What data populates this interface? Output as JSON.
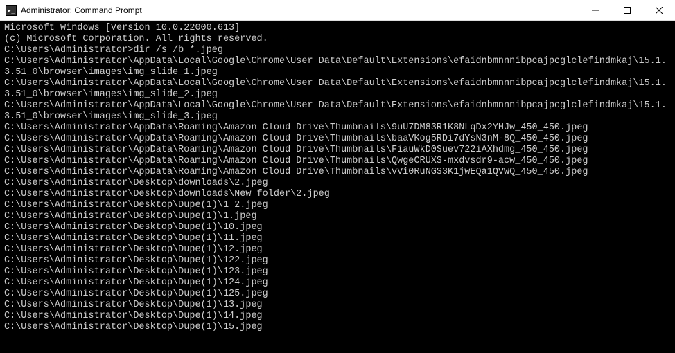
{
  "window": {
    "title": "Administrator: Command Prompt"
  },
  "terminal": {
    "header_lines": [
      "Microsoft Windows [Version 10.0.22000.613]",
      "(c) Microsoft Corporation. All rights reserved.",
      ""
    ],
    "prompt": "C:\\Users\\Administrator>",
    "command": "dir /s /b *.jpeg",
    "output_lines": [
      "C:\\Users\\Administrator\\AppData\\Local\\Google\\Chrome\\User Data\\Default\\Extensions\\efaidnbmnnnibpcajpcglclefindmkaj\\15.1.3.51_0\\browser\\images\\img_slide_1.jpeg",
      "C:\\Users\\Administrator\\AppData\\Local\\Google\\Chrome\\User Data\\Default\\Extensions\\efaidnbmnnnibpcajpcglclefindmkaj\\15.1.3.51_0\\browser\\images\\img_slide_2.jpeg",
      "C:\\Users\\Administrator\\AppData\\Local\\Google\\Chrome\\User Data\\Default\\Extensions\\efaidnbmnnnibpcajpcglclefindmkaj\\15.1.3.51_0\\browser\\images\\img_slide_3.jpeg",
      "C:\\Users\\Administrator\\AppData\\Roaming\\Amazon Cloud Drive\\Thumbnails\\9uU7DM83R1K8NLqDx2YHJw_450_450.jpeg",
      "C:\\Users\\Administrator\\AppData\\Roaming\\Amazon Cloud Drive\\Thumbnails\\baaVKog5RDi7dYsN3nM-8Q_450_450.jpeg",
      "C:\\Users\\Administrator\\AppData\\Roaming\\Amazon Cloud Drive\\Thumbnails\\FiauWkD0Suev722iAXhdmg_450_450.jpeg",
      "C:\\Users\\Administrator\\AppData\\Roaming\\Amazon Cloud Drive\\Thumbnails\\QwgeCRUXS-mxdvsdr9-acw_450_450.jpeg",
      "C:\\Users\\Administrator\\AppData\\Roaming\\Amazon Cloud Drive\\Thumbnails\\vVi0RuNGS3K1jwEQa1QVWQ_450_450.jpeg",
      "C:\\Users\\Administrator\\Desktop\\downloads\\2.jpeg",
      "C:\\Users\\Administrator\\Desktop\\downloads\\New folder\\2.jpeg",
      "C:\\Users\\Administrator\\Desktop\\Dupe(1)\\1 2.jpeg",
      "C:\\Users\\Administrator\\Desktop\\Dupe(1)\\1.jpeg",
      "C:\\Users\\Administrator\\Desktop\\Dupe(1)\\10.jpeg",
      "C:\\Users\\Administrator\\Desktop\\Dupe(1)\\11.jpeg",
      "C:\\Users\\Administrator\\Desktop\\Dupe(1)\\12.jpeg",
      "C:\\Users\\Administrator\\Desktop\\Dupe(1)\\122.jpeg",
      "C:\\Users\\Administrator\\Desktop\\Dupe(1)\\123.jpeg",
      "C:\\Users\\Administrator\\Desktop\\Dupe(1)\\124.jpeg",
      "C:\\Users\\Administrator\\Desktop\\Dupe(1)\\125.jpeg",
      "C:\\Users\\Administrator\\Desktop\\Dupe(1)\\13.jpeg",
      "C:\\Users\\Administrator\\Desktop\\Dupe(1)\\14.jpeg",
      "C:\\Users\\Administrator\\Desktop\\Dupe(1)\\15.jpeg"
    ]
  }
}
